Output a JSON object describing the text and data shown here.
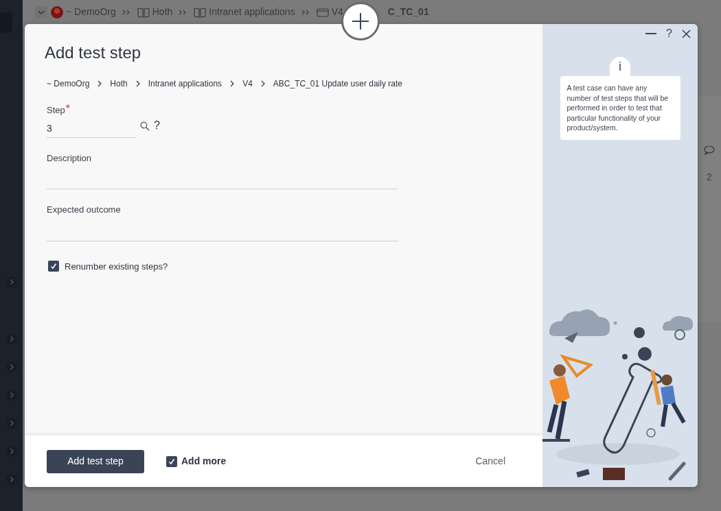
{
  "background": {
    "breadcrumb": [
      {
        "label": "~ DemoOrg",
        "kind": "org"
      },
      {
        "label": "Hoth",
        "kind": "book"
      },
      {
        "label": "Intranet applications",
        "kind": "book"
      },
      {
        "label": "V4",
        "kind": "folder"
      },
      {
        "label": "C_TC_01",
        "kind": "text"
      }
    ],
    "side_value": "2"
  },
  "dialog": {
    "title": "Add test step",
    "help": "?",
    "breadcrumb": [
      "~ DemoOrg",
      "Hoth",
      "Intranet applications",
      "V4",
      "ABC_TC_01 Update user daily rate"
    ],
    "fields": [
      {
        "label": "Step",
        "required_mark": "*",
        "value": "3",
        "kind": "lookup",
        "help": "?"
      },
      {
        "label": "Description",
        "kind": "text"
      },
      {
        "label": "Expected outcome",
        "kind": "text"
      }
    ],
    "renumber": {
      "label": "Renumber existing steps?",
      "checked": true
    },
    "info": {
      "icon": "i",
      "text": "A test case can have any number of test steps that will be performed in order to test that particular functionality of your product/system."
    },
    "footer": {
      "submit": "Add test step",
      "add_more": {
        "label": "Add more",
        "checked": true
      },
      "cancel": "Cancel"
    }
  }
}
